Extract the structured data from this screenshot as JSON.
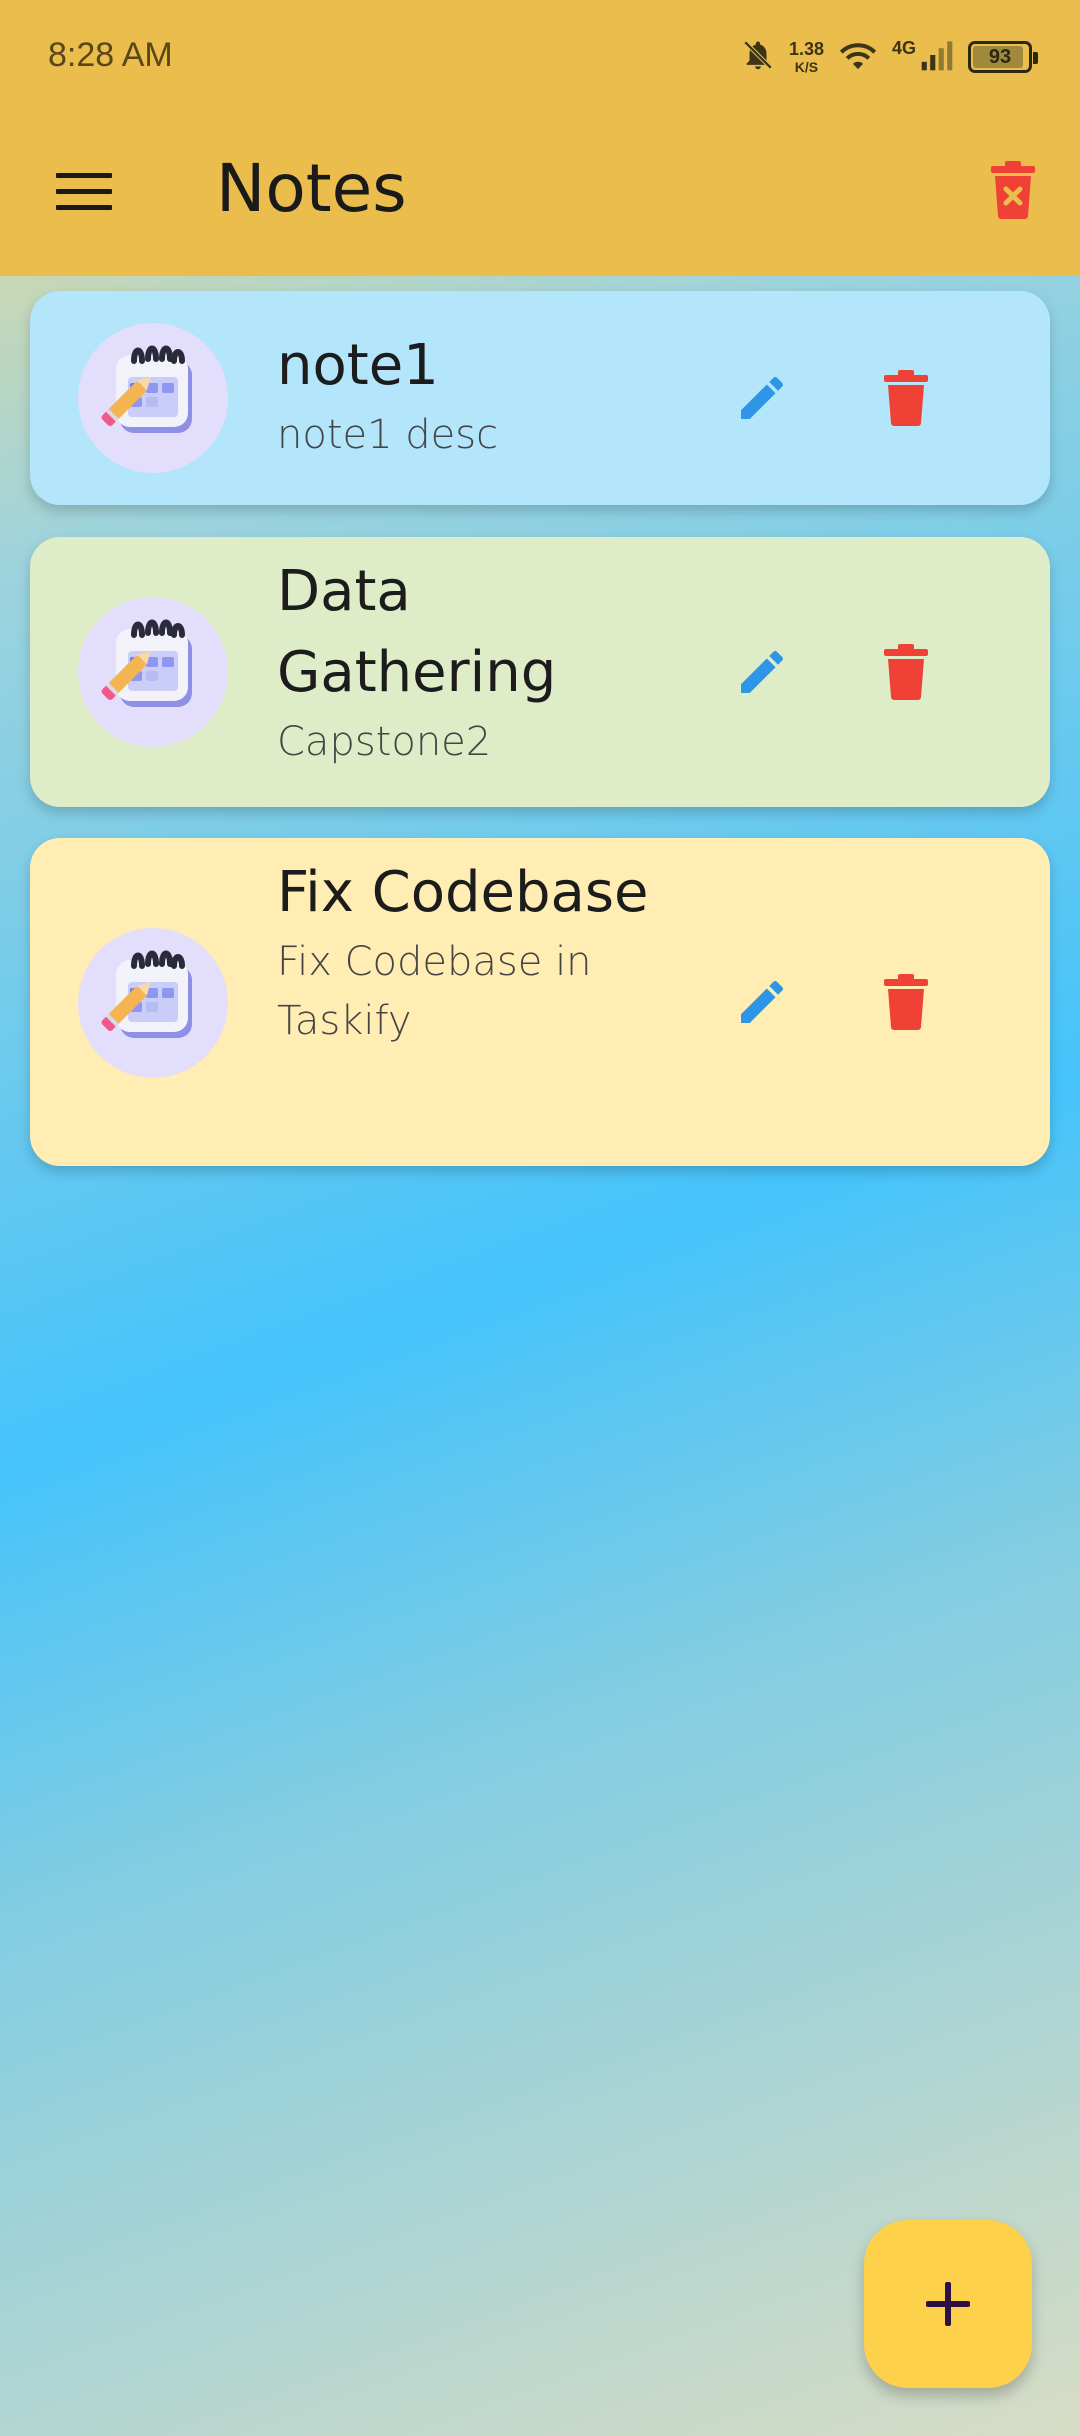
{
  "status_bar": {
    "time": "8:28 AM",
    "net_speed_value": "1.38",
    "net_speed_unit": "K/S",
    "network_type": "4G",
    "battery_level": "93",
    "icons": [
      "mute-bell-icon",
      "wifi-icon",
      "cellular-signal-icon",
      "battery-icon"
    ]
  },
  "app_bar": {
    "title": "Notes",
    "menu_icon": "hamburger-menu-icon",
    "clear_icon": "delete-all-icon"
  },
  "notes": [
    {
      "title": "note1",
      "description": "note1 desc",
      "background": "#b3e5fb"
    },
    {
      "title": "Data Gathering",
      "description": "Capstone2",
      "background": "#dfecc8"
    },
    {
      "title": "Fix Codebase",
      "description": "Fix Codebase in Taskify",
      "background": "#ffedb3"
    }
  ],
  "colors": {
    "app_bar": "#eabd4c",
    "edit_icon": "#2e96e6",
    "delete_icon": "#f04136",
    "fab": "#fed14a",
    "fab_icon": "#2b1240"
  },
  "fab": {
    "icon": "plus-icon"
  }
}
